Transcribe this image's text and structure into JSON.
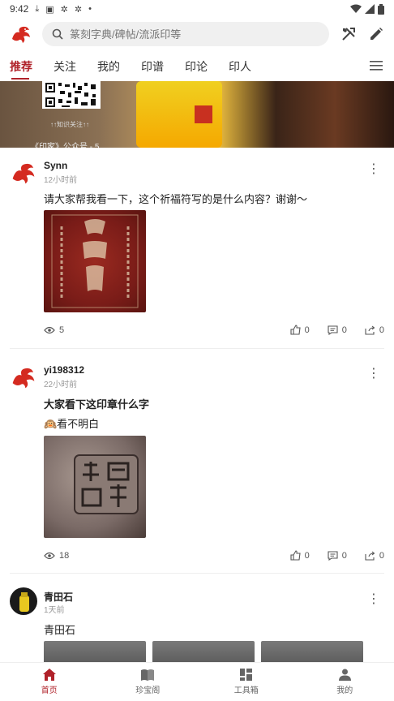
{
  "status_bar": {
    "time": "9:42",
    "icons": [
      "download-icon",
      "a-icon",
      "bug-icon",
      "bug-icon",
      "dot-icon"
    ],
    "right_icons": [
      "wifi-icon",
      "signal-icon",
      "battery-icon"
    ]
  },
  "top_bar": {
    "logo": "dragon-logo",
    "search_placeholder": "篆刻字典/碑帖/流派印等",
    "actions": [
      "tools-icon",
      "edit-icon"
    ]
  },
  "tabs": {
    "items": [
      {
        "label": "推荐",
        "active": true
      },
      {
        "label": "关注",
        "active": false
      },
      {
        "label": "我的",
        "active": false
      },
      {
        "label": "印谱",
        "active": false
      },
      {
        "label": "印论",
        "active": false
      },
      {
        "label": "印人",
        "active": false
      }
    ],
    "menu_icon": "menu-icon"
  },
  "banner": {
    "caption_small": "↑↑知识关注↑↑",
    "caption": "《印家》公众号 - 5"
  },
  "posts": [
    {
      "user": "Synn",
      "time": "12小时前",
      "title": "请大家帮我看一下，这个祈福符写的是什么内容？谢谢～",
      "body": "",
      "views": "5",
      "likes": "0",
      "comments": "0",
      "shares": "0"
    },
    {
      "user": "yi198312",
      "time": "22小时前",
      "title": "大家看下这印章什么字",
      "body": "🙉看不明白",
      "views": "18",
      "likes": "0",
      "comments": "0",
      "shares": "0"
    },
    {
      "user": "青田石",
      "time": "1天前",
      "title": "青田石",
      "body": ""
    }
  ],
  "bottom_nav": {
    "items": [
      {
        "label": "首页",
        "icon": "home-icon",
        "active": true
      },
      {
        "label": "珍宝阁",
        "icon": "book-icon",
        "active": false
      },
      {
        "label": "工具箱",
        "icon": "grid-icon",
        "active": false
      },
      {
        "label": "我的",
        "icon": "person-icon",
        "active": false
      }
    ]
  },
  "colors": {
    "accent": "#b0222a"
  }
}
